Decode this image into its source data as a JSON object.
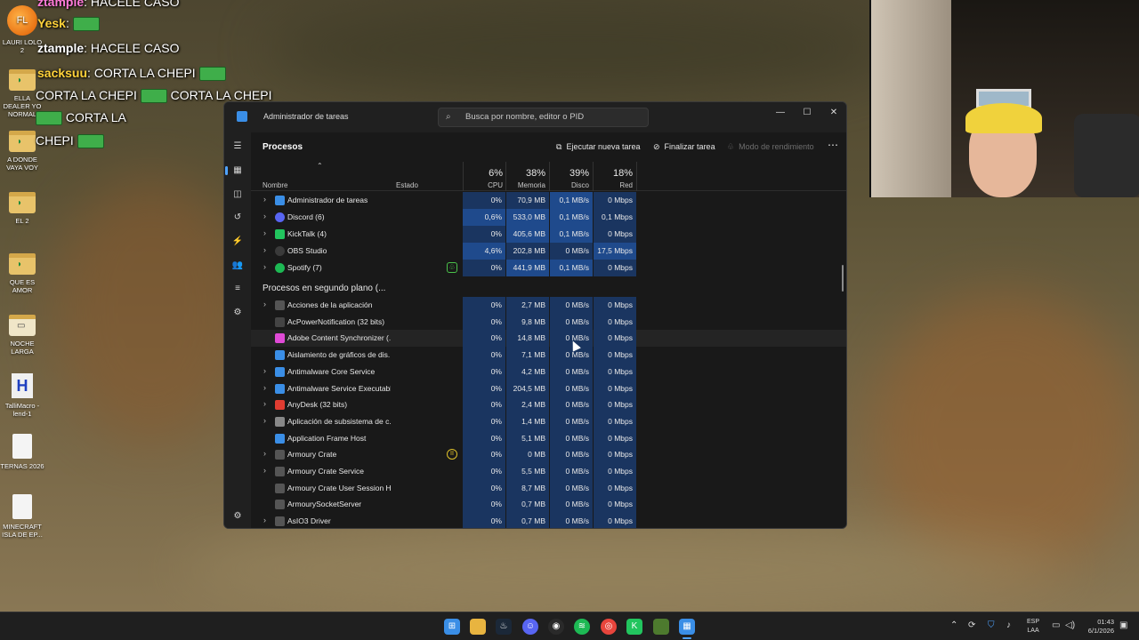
{
  "desktop": {
    "icons": [
      {
        "label": "LAURI LOLO 2"
      },
      {
        "label": "ELLA DEALER YO NORMAL"
      },
      {
        "label": "A DONDE VAYA VOY"
      },
      {
        "label": "EL 2"
      },
      {
        "label": "QUE ES AMOR"
      },
      {
        "label": "NOCHE LARGA"
      },
      {
        "label": "TalliMacro - lend-1"
      },
      {
        "label": "TERNAS 2026"
      },
      {
        "label": "MINECRAFT ISLA DE EP..."
      }
    ]
  },
  "chat": {
    "lines": [
      {
        "user": "ztample",
        "text": ": HACELE CASO"
      },
      {
        "user": "Yesk",
        "text": ":"
      },
      {
        "user": "ztample",
        "text": ": HACELE CASO"
      },
      {
        "user": "sacksuu",
        "text": ": CORTA LA CHEPI"
      },
      {
        "text": "CORTA LA CHEPI"
      },
      {
        "text": "CORTA LA CHEPI"
      },
      {
        "text": "CORTA LA"
      },
      {
        "text": "CHEPI"
      }
    ]
  },
  "taskmgr": {
    "title": "Administrador de tareas",
    "search_placeholder": "Busca por nombre, editor o PID",
    "heading": "Procesos",
    "toolbar": {
      "new_task": "Ejecutar nueva tarea",
      "end_task": "Finalizar tarea",
      "efficiency": "Modo de rendimiento"
    },
    "columns": {
      "name": "Nombre",
      "status": "Estado",
      "cpu": {
        "pct": "6%",
        "label": "CPU"
      },
      "mem": {
        "pct": "38%",
        "label": "Memoria"
      },
      "disk": {
        "pct": "39%",
        "label": "Disco"
      },
      "net": {
        "pct": "18%",
        "label": "Red"
      }
    },
    "apps": [
      {
        "name": "Administrador de tareas",
        "icon_color": "#3a8ee6",
        "cpu": "0%",
        "mem": "70,9 MB",
        "disk": "0,1 MB/s",
        "net": "0 Mbps"
      },
      {
        "name": "Discord (6)",
        "icon_color": "#5865f2",
        "cpu": "0,6%",
        "mem": "533,0 MB",
        "disk": "0,1 MB/s",
        "net": "0,1 Mbps"
      },
      {
        "name": "KickTalk (4)",
        "icon_color": "#22c55e",
        "cpu": "0%",
        "mem": "405,6 MB",
        "disk": "0,1 MB/s",
        "net": "0 Mbps"
      },
      {
        "name": "OBS Studio",
        "icon_color": "#3a3a3a",
        "cpu": "4,6%",
        "mem": "202,8 MB",
        "disk": "0 MB/s",
        "net": "17,5 Mbps"
      },
      {
        "name": "Spotify (7)",
        "icon_color": "#1db954",
        "cpu": "0%",
        "mem": "441,9 MB",
        "disk": "0,1 MB/s",
        "net": "0 Mbps"
      }
    ],
    "background_heading": "Procesos en segundo plano (...",
    "background": [
      {
        "name": "Acciones de la aplicación",
        "icon_color": "#555555",
        "cpu": "0%",
        "mem": "2,7 MB",
        "disk": "0 MB/s",
        "net": "0 Mbps"
      },
      {
        "name": "AcPowerNotification (32 bits)",
        "icon_color": "#444444",
        "cpu": "0%",
        "mem": "9,8 MB",
        "disk": "0 MB/s",
        "net": "0 Mbps"
      },
      {
        "name": "Adobe Content Synchronizer (...",
        "icon_color": "#e04ad6",
        "cpu": "0%",
        "mem": "14,8 MB",
        "disk": "0 MB/s",
        "net": "0 Mbps"
      },
      {
        "name": "Aislamiento de gráficos de dis...",
        "icon_color": "#3a8ee6",
        "cpu": "0%",
        "mem": "7,1 MB",
        "disk": "0 MB/s",
        "net": "0 Mbps"
      },
      {
        "name": "Antimalware Core Service",
        "icon_color": "#3a8ee6",
        "cpu": "0%",
        "mem": "4,2 MB",
        "disk": "0 MB/s",
        "net": "0 Mbps"
      },
      {
        "name": "Antimalware Service Executable",
        "icon_color": "#3a8ee6",
        "cpu": "0%",
        "mem": "204,5 MB",
        "disk": "0 MB/s",
        "net": "0 Mbps"
      },
      {
        "name": "AnyDesk (32 bits)",
        "icon_color": "#e03c31",
        "cpu": "0%",
        "mem": "2,4 MB",
        "disk": "0 MB/s",
        "net": "0 Mbps"
      },
      {
        "name": "Aplicación de subsistema de c...",
        "icon_color": "#888888",
        "cpu": "0%",
        "mem": "1,4 MB",
        "disk": "0 MB/s",
        "net": "0 Mbps"
      },
      {
        "name": "Application Frame Host",
        "icon_color": "#3a8ee6",
        "cpu": "0%",
        "mem": "5,1 MB",
        "disk": "0 MB/s",
        "net": "0 Mbps"
      },
      {
        "name": "Armoury Crate",
        "icon_color": "#555555",
        "cpu": "0%",
        "mem": "0 MB",
        "disk": "0 MB/s",
        "net": "0 Mbps"
      },
      {
        "name": "Armoury Crate Service",
        "icon_color": "#555555",
        "cpu": "0%",
        "mem": "5,5 MB",
        "disk": "0 MB/s",
        "net": "0 Mbps"
      },
      {
        "name": "Armoury Crate User Session H...",
        "icon_color": "#555555",
        "cpu": "0%",
        "mem": "8,7 MB",
        "disk": "0 MB/s",
        "net": "0 Mbps"
      },
      {
        "name": "ArmourySocketServer",
        "icon_color": "#555555",
        "cpu": "0%",
        "mem": "0,7 MB",
        "disk": "0 MB/s",
        "net": "0 Mbps"
      },
      {
        "name": "AsIO3 Driver",
        "icon_color": "#555555",
        "cpu": "0%",
        "mem": "0,7 MB",
        "disk": "0 MB/s",
        "net": "0 Mbps"
      }
    ]
  },
  "taskbar": {
    "lang_top": "ESP",
    "lang_bottom": "LAA",
    "time": "01:43",
    "date": "6/1/2026"
  }
}
